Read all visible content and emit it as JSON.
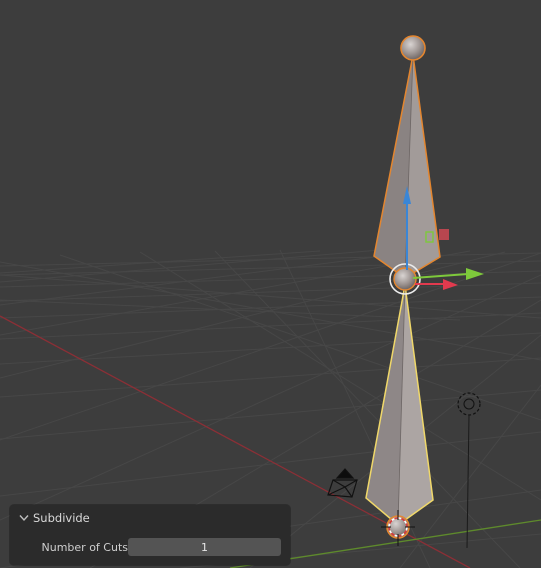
{
  "viewport": {
    "background": "#3d3d3d",
    "grid_color": "#474747",
    "x_axis_color": "#8b2f36",
    "y_axis_color": "#5e8a2c",
    "selection_color": "#e4862f",
    "active_bone_outline": "#f0d86a",
    "gizmo_x_color": "#e23a4e",
    "gizmo_y_color": "#7ec93b",
    "gizmo_z_color": "#3a86d6",
    "objects": [
      "armature-bone-upper",
      "armature-bone-lower",
      "camera-object",
      "light-object",
      "3d-cursor"
    ]
  },
  "operator_panel": {
    "title": "Subdivide",
    "expanded": true,
    "fields": [
      {
        "label": "Number of Cuts",
        "value": "1"
      }
    ]
  }
}
